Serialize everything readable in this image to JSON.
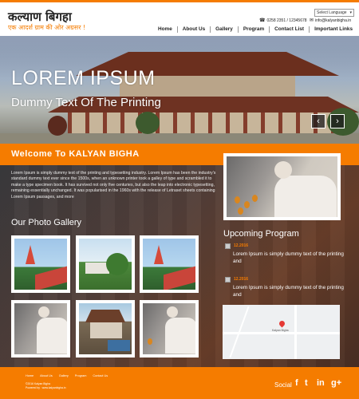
{
  "header": {
    "title": "कल्याण बिगहा",
    "subtitle": "एक आदर्श ग्राम की ओर अग्रसर !",
    "language_select": "Select Language",
    "phone": "0258 2351 / 12345678",
    "email": "info@kalyanbigha.in",
    "nav": [
      "Home",
      "About Us",
      "Gallery",
      "Program",
      "Contact List",
      "Important Links"
    ]
  },
  "hero": {
    "title": "LOREM IPSUM",
    "subtitle": "Dummy Text Of The Printing",
    "prev_label": "‹",
    "next_label": "›"
  },
  "welcome": {
    "title": "Welcome To KALYAN BIGHA",
    "body": "Lorem Ipsum is simply dummy text of the printing and typesetting industry. Lorem Ipsum has been the industry's standard dummy text ever since the 1500s, when an unknown printer took a galley of type and scrambled it to make a type specimen book. It has survived not only five centuries, but also the leap into electronic typesetting, remaining essentially unchanged. It was popularised in the 1960s with the release of Letraset sheets containing Lorem Ipsum passages, and more"
  },
  "gallery": {
    "title": "Our Photo Gallery"
  },
  "upcoming": {
    "title": "Upcoming Program",
    "events": [
      {
        "date": "12.2016",
        "text": "Lorem Ipsum is simply dummy text of the printing and"
      },
      {
        "date": "12.2016",
        "text": "Lorem Ipsum is simply dummy text of the printing and"
      }
    ]
  },
  "map": {
    "label": "Kalyan Bigha"
  },
  "footer": {
    "links": [
      "Home",
      "About Us",
      "Gallery",
      "Program",
      "Contact Us"
    ],
    "copyright": "©2016 Kalyan Bigha",
    "powered": "Powered by : www.kalyanbigha.in",
    "social_label": "Social",
    "social_icons": [
      "f",
      "t",
      "in",
      "g+"
    ]
  },
  "colors": {
    "accent": "#f57c00",
    "header_bg": "#ffffff",
    "footer_bg": "#f57c00"
  }
}
